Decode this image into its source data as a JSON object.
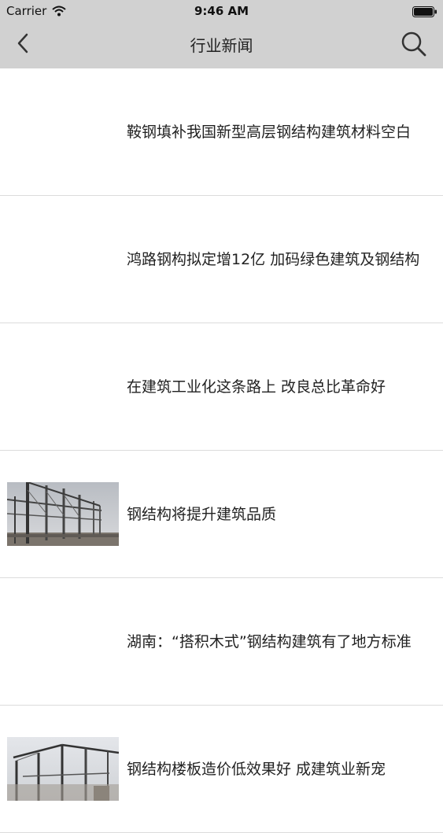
{
  "status_bar": {
    "carrier": "Carrier",
    "time": "9:46 AM",
    "icons": [
      "wifi-icon",
      "battery-icon"
    ]
  },
  "nav": {
    "title": "行业新闻",
    "back_icon": "chevron-left-icon",
    "search_icon": "search-icon",
    "background": "#d1d1d1"
  },
  "news": [
    {
      "title": "鞍钢填补我国新型高层钢结构建筑材料空白",
      "thumbnail": "none"
    },
    {
      "title": "鸿路钢构拟定增12亿 加码绿色建筑及钢结构",
      "thumbnail": "none"
    },
    {
      "title": "在建筑工业化这条路上 改良总比革命好",
      "thumbnail": "none"
    },
    {
      "title": "钢结构将提升建筑品质",
      "thumbnail": "steel-frame-photo"
    },
    {
      "title": "湖南：“搭积木式”钢结构建筑有了地方标准",
      "thumbnail": "none"
    },
    {
      "title": "钢结构楼板造价低效果好 成建筑业新宠",
      "thumbnail": "steel-frame-photo"
    }
  ]
}
